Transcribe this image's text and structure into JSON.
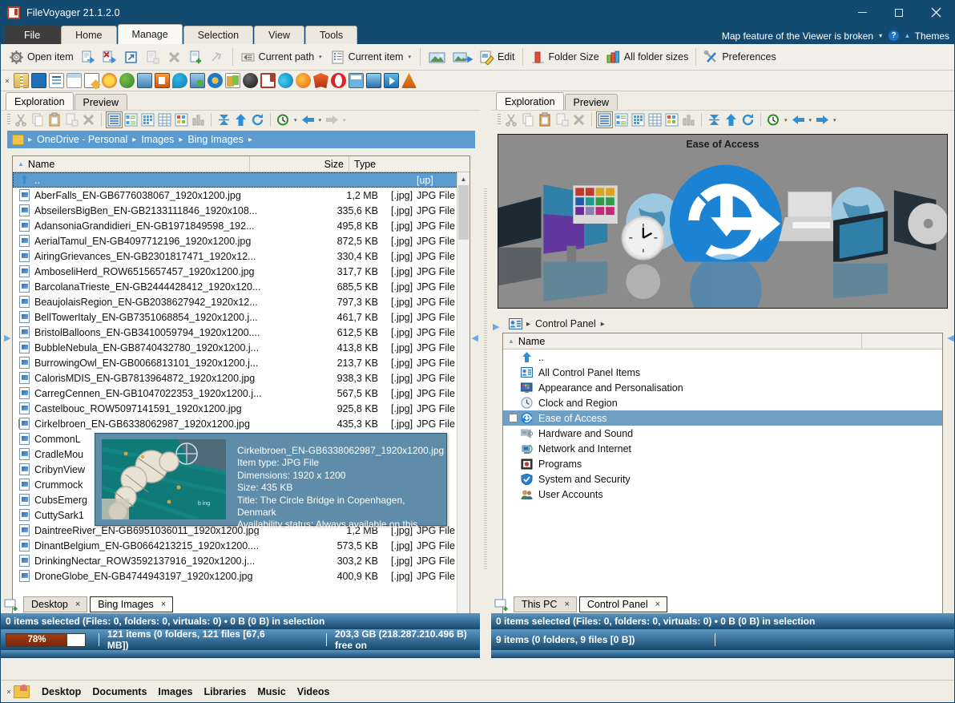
{
  "window": {
    "title": "FileVoyager 21.1.2.0",
    "app_icon": "filevoyager-logo-icon",
    "minimize": "–",
    "maximize": "□",
    "close": "✕"
  },
  "ribbon": {
    "tabs": [
      {
        "label": "File",
        "active": false,
        "kind": "file"
      },
      {
        "label": "Home",
        "active": false
      },
      {
        "label": "Manage",
        "active": true
      },
      {
        "label": "Selection",
        "active": false
      },
      {
        "label": "View",
        "active": false
      },
      {
        "label": "Tools",
        "active": false
      }
    ],
    "notice": "Map feature of the Viewer is broken",
    "notice_caret": "▾",
    "help_glyph": "?",
    "collapse_caret": "▴",
    "themes_label": "Themes",
    "buttons": [
      {
        "label": "Open item",
        "icon": "gear-open-item-icon",
        "disabled": false
      },
      {
        "label": "",
        "icon": "copy-to-icon",
        "disabled": false
      },
      {
        "label": "",
        "icon": "move-delete-icon",
        "disabled": false
      },
      {
        "label": "",
        "icon": "shortcut-icon",
        "disabled": false
      },
      {
        "label": "",
        "icon": "paste-into-icon",
        "disabled": true
      },
      {
        "label": "",
        "icon": "delete-x-icon",
        "disabled": true
      },
      {
        "label": "",
        "icon": "new-file-icon",
        "disabled": false
      },
      {
        "label": "",
        "icon": "rename-tag-icon",
        "disabled": true
      },
      {
        "label": "Current path",
        "icon": "current-path-icon",
        "caret": "▾"
      },
      {
        "label": "Current item",
        "icon": "current-item-icon",
        "caret": "▾"
      },
      {
        "label": "",
        "icon": "view-image-icon"
      },
      {
        "label": "",
        "icon": "send-image-icon"
      },
      {
        "label": "Edit",
        "icon": "edit-pencil-icon"
      },
      {
        "label": "Folder Size",
        "icon": "folder-size-chart-icon"
      },
      {
        "label": "All folder sizes",
        "icon": "all-folder-sizes-chart-icon"
      },
      {
        "label": "Preferences",
        "icon": "preferences-tools-icon"
      }
    ]
  },
  "launcher": {
    "close_glyph": "×",
    "icons": [
      "archive-zip-icon",
      "screen-blue-icon",
      "document-text-icon",
      "window-small-icon",
      "notepad-edit-icon",
      "sun-colors-icon",
      "globe-paint-icon",
      "photo-tools-icon",
      "orange-app-icon",
      "cyan-teardrop-icon",
      "lock-folder-icon",
      "blue-gear-icon",
      "transfer-files-icon",
      "dark-globe-icon",
      "filevoyager-icon",
      "edge-browser-icon",
      "firefox-browser-icon",
      "brave-browser-icon",
      "opera-browser-icon",
      "calculator-icon",
      "image-viewer-icon",
      "media-player-icon",
      "vlc-cone-icon"
    ]
  },
  "left_panel": {
    "tabs": [
      {
        "label": "Exploration",
        "active": true
      },
      {
        "label": "Preview",
        "active": false
      }
    ],
    "toolbar_icons": [
      "cut-icon",
      "copy-icon",
      "paste-icon",
      "paste-into-icon",
      "delete-icon",
      "view-list-icon",
      "view-details-icon",
      "view-tiles-icon",
      "view-table-icon",
      "view-grid-icon",
      "view-columns-icon",
      "collapse-all-icon",
      "up-folder-icon",
      "refresh-icon",
      "history-clock-icon",
      "back-arrow-icon",
      "forward-arrow-icon"
    ],
    "breadcrumb": [
      "OneDrive - Personal",
      "Images",
      "Bing Images"
    ],
    "columns": [
      "Name",
      "Size",
      "Type"
    ],
    "sort_indicator": "▲",
    "rows": [
      {
        "name": "..",
        "size": "",
        "ext": "",
        "type": "[up]",
        "kind": "up",
        "selected": true
      },
      {
        "name": "AberFalls_EN-GB6776038067_1920x1200.jpg",
        "size": "1,2 MB",
        "ext": "[.jpg]",
        "type": "JPG File"
      },
      {
        "name": "AbseilersBigBen_EN-GB2133111846_1920x108...",
        "size": "335,6 KB",
        "ext": "[.jpg]",
        "type": "JPG File"
      },
      {
        "name": "AdansoniaGrandidieri_EN-GB1971849598_192...",
        "size": "495,8 KB",
        "ext": "[.jpg]",
        "type": "JPG File"
      },
      {
        "name": "AerialTamul_EN-GB4097712196_1920x1200.jpg",
        "size": "872,5 KB",
        "ext": "[.jpg]",
        "type": "JPG File"
      },
      {
        "name": "AiringGrievances_EN-GB2301817471_1920x12...",
        "size": "330,4 KB",
        "ext": "[.jpg]",
        "type": "JPG File"
      },
      {
        "name": "AmboseliHerd_ROW6515657457_1920x1200.jpg",
        "size": "317,7 KB",
        "ext": "[.jpg]",
        "type": "JPG File"
      },
      {
        "name": "BarcolanaTrieste_EN-GB2444428412_1920x120...",
        "size": "685,5 KB",
        "ext": "[.jpg]",
        "type": "JPG File"
      },
      {
        "name": "BeaujolaisRegion_EN-GB2038627942_1920x12...",
        "size": "797,3 KB",
        "ext": "[.jpg]",
        "type": "JPG File"
      },
      {
        "name": "BellTowerItaly_EN-GB7351068854_1920x1200.j...",
        "size": "461,7 KB",
        "ext": "[.jpg]",
        "type": "JPG File"
      },
      {
        "name": "BristolBalloons_EN-GB3410059794_1920x1200....",
        "size": "612,5 KB",
        "ext": "[.jpg]",
        "type": "JPG File"
      },
      {
        "name": "BubbleNebula_EN-GB8740432780_1920x1200.j...",
        "size": "413,8 KB",
        "ext": "[.jpg]",
        "type": "JPG File"
      },
      {
        "name": "BurrowingOwl_EN-GB0066813101_1920x1200.j...",
        "size": "213,7 KB",
        "ext": "[.jpg]",
        "type": "JPG File"
      },
      {
        "name": "CalorisMDIS_EN-GB7813964872_1920x1200.jpg",
        "size": "938,3 KB",
        "ext": "[.jpg]",
        "type": "JPG File"
      },
      {
        "name": "CarregCennen_EN-GB1047022353_1920x1200.j...",
        "size": "567,5 KB",
        "ext": "[.jpg]",
        "type": "JPG File"
      },
      {
        "name": "Castelbouc_ROW5097141591_1920x1200.jpg",
        "size": "925,8 KB",
        "ext": "[.jpg]",
        "type": "JPG File"
      },
      {
        "name": "Cirkelbroen_EN-GB6338062987_1920x1200.jpg",
        "size": "435,3 KB",
        "ext": "[.jpg]",
        "type": "JPG File",
        "hovered": true
      },
      {
        "name": "CommonL",
        "size": "",
        "ext": "",
        "type": "",
        "clipped": true
      },
      {
        "name": "CradleMou",
        "size": "",
        "ext": "",
        "type": "",
        "clipped": true
      },
      {
        "name": "CribynView",
        "size": "",
        "ext": "",
        "type": "",
        "clipped": true
      },
      {
        "name": "Crummock",
        "size": "",
        "ext": "",
        "type": "",
        "clipped": true
      },
      {
        "name": "CubsEmerg",
        "size": "",
        "ext": "",
        "type": "",
        "clipped": true
      },
      {
        "name": "CuttySark1",
        "size": "",
        "ext": "",
        "type": "",
        "clipped": true
      },
      {
        "name": "DaintreeRiver_EN-GB6951036011_1920x1200.jpg",
        "size": "1,2 MB",
        "ext": "[.jpg]",
        "type": "JPG File"
      },
      {
        "name": "DinantBelgium_EN-GB0664213215_1920x1200....",
        "size": "573,5 KB",
        "ext": "[.jpg]",
        "type": "JPG File"
      },
      {
        "name": "DrinkingNectar_ROW3592137916_1920x1200.j...",
        "size": "303,2 KB",
        "ext": "[.jpg]",
        "type": "JPG File"
      },
      {
        "name": "DroneGlobe_EN-GB4744943197_1920x1200.jpg",
        "size": "400,9 KB",
        "ext": "[.jpg]",
        "type": "JPG File"
      }
    ],
    "bottom_tabs": [
      {
        "label": "Desktop",
        "close": "×",
        "selected": false
      },
      {
        "label": "Bing Images",
        "close": "×",
        "selected": true
      }
    ],
    "status_selection": "0 items selected (Files: 0, folders: 0, virtuals: 0) • 0 B (0 B) in selection",
    "progress_label": "78%",
    "progress_value": 78,
    "status_items": "121 items (0 folders, 121 files [67,6 MB])",
    "status_free": "203,3 GB (218.287.210.496 B) free on"
  },
  "tooltip": {
    "filename": "Cirkelbroen_EN-GB6338062987_1920x1200.jpg",
    "item_type": "Item type: JPG File",
    "dimensions": "Dimensions: 1920 x 1200",
    "size": "Size: 435 KB",
    "title": "Title: The Circle Bridge in Copenhagen, Denmark",
    "availability": "Availability status: Always available on this device",
    "thumb_name": "circle-bridge-thumbnail"
  },
  "right_panel": {
    "tabs": [
      {
        "label": "Exploration",
        "active": true
      },
      {
        "label": "Preview",
        "active": false
      }
    ],
    "toolbar_icons": [
      "cut-icon",
      "copy-icon",
      "paste-icon",
      "paste-into-icon",
      "delete-icon",
      "view-list-icon",
      "view-details-icon",
      "view-tiles-icon",
      "view-table-icon",
      "view-grid-icon",
      "view-columns-icon",
      "collapse-all-icon",
      "up-folder-icon",
      "refresh-icon",
      "history-clock-icon",
      "back-arrow-icon",
      "forward-arrow-icon"
    ],
    "preview_title": "Ease of Access",
    "breadcrumb": [
      "Control Panel"
    ],
    "columns": [
      "Name",
      ""
    ],
    "sort_indicator": "▲",
    "rows": [
      {
        "name": "..",
        "icon": "up-folder-icon",
        "kind": "up"
      },
      {
        "name": "All Control Panel Items",
        "icon": "control-panel-icon"
      },
      {
        "name": "Appearance and Personalisation",
        "icon": "appearance-icon"
      },
      {
        "name": "Clock and Region",
        "icon": "clock-icon"
      },
      {
        "name": "Ease of Access",
        "icon": "ease-of-access-icon",
        "selected": true
      },
      {
        "name": "Hardware and Sound",
        "icon": "hardware-sound-icon"
      },
      {
        "name": "Network and Internet",
        "icon": "network-icon"
      },
      {
        "name": "Programs",
        "icon": "programs-icon"
      },
      {
        "name": "System and Security",
        "icon": "system-security-icon"
      },
      {
        "name": "User Accounts",
        "icon": "user-accounts-icon"
      }
    ],
    "bottom_tabs": [
      {
        "label": "This PC",
        "close": "×",
        "selected": false
      },
      {
        "label": "Control Panel",
        "close": "×",
        "selected": true
      }
    ],
    "status_selection": "0 items selected (Files: 0, folders: 0, virtuals: 0) • 0 B (0 B) in selection",
    "status_items": "9 items (0 folders, 9 files [0 B])"
  },
  "favorites": {
    "close_glyph": "×",
    "icon": "favorites-folder-heart-icon",
    "items": [
      "Desktop",
      "Documents",
      "Images",
      "Libraries",
      "Music",
      "Videos"
    ]
  },
  "colors": {
    "titlebar": "#134a70",
    "accent_blue": "#5b9bd0",
    "ribbon_bg": "#f2efe8",
    "status_bar": "#17486c",
    "progress_fill": "#8b2f0c"
  }
}
